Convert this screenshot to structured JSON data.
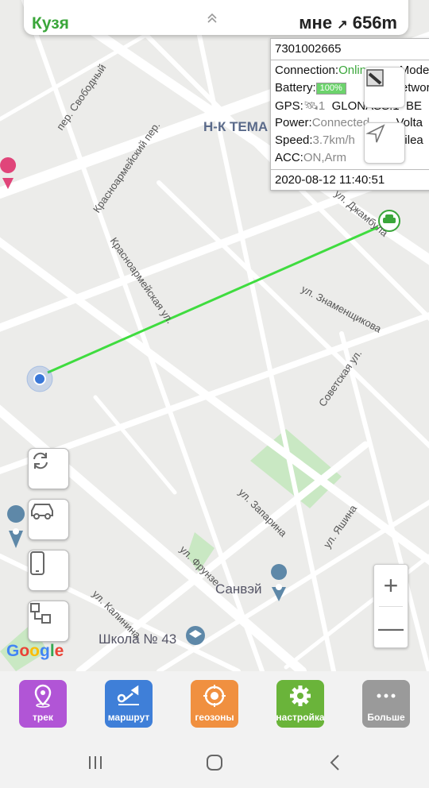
{
  "top_card": {
    "name": "Кузя",
    "distance_label": "мне",
    "distance": "656m"
  },
  "info": {
    "imei": "7301002665",
    "connection_key": "Connection:",
    "connection_val": "Online",
    "mode_key": "Mode",
    "battery_key": "Battery:",
    "battery_val": "100%",
    "network_key": "Network",
    "gps_key": "GPS:",
    "gps_val": "1",
    "glonass": "GLONASS:1",
    "beidou": "BE",
    "power_key": "Power:",
    "power_val": "Connected",
    "voltage_key": "Volta",
    "speed_key": "Speed:",
    "speed_val": "3.7km/h",
    "mileage_key": "Milea",
    "acc_key": "ACC:",
    "acc_val": "ON,Arm",
    "timestamp": "2020-08-12 11:40:51"
  },
  "map_labels": {
    "svobodny": "пер. Свободный",
    "krasnoarm_per": "Красноармейский пер.",
    "nk_tema": "Н-К ТЕМА",
    "dzhambula": "ул. Джамбула",
    "krasnoarm_ul": "Красноармейская ул.",
    "znamenshchikova": "ул. Знаменщикова",
    "sovetskaya": "Советская ул.",
    "zaparina": "ул. Запарина",
    "yashina": "ул. Яшина",
    "frunze": "ул. Фрунзе",
    "sanvey": "Санвэй",
    "kalinina": "ул. Калинина",
    "school": "Школа № 43",
    "google": "Google"
  },
  "zoom": {
    "plus": "+",
    "minus": "—"
  },
  "bottom_tabs": [
    {
      "label": "трек",
      "color": "#b155d6",
      "icon": "map-pin-icon"
    },
    {
      "label": "маршрут",
      "color": "#3f7fd8",
      "icon": "route-icon"
    },
    {
      "label": "геозоны",
      "color": "#f09040",
      "icon": "geofence-icon"
    },
    {
      "label": "настройка",
      "color": "#6ab43a",
      "icon": "gear-icon"
    },
    {
      "label": "Больше",
      "color": "#9a9a9a",
      "icon": "more-icon"
    }
  ],
  "colors": {
    "accent_green": "#3aa63a",
    "track_line": "#3fdc3f",
    "user_dot": "#3a78d8"
  }
}
